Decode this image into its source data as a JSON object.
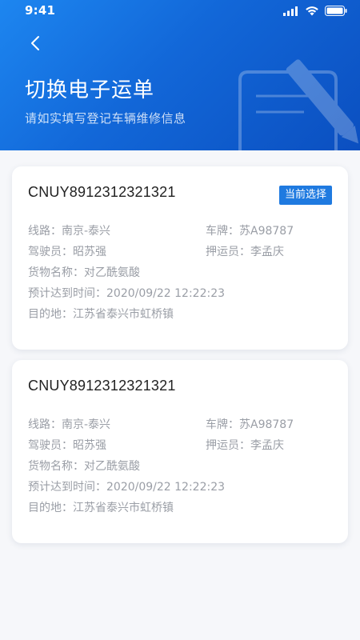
{
  "status_bar": {
    "time": "9:41"
  },
  "header": {
    "title": "切换电子运单",
    "subtitle": "请如实填写登记车辆维修信息"
  },
  "labels": {
    "route": "线路：",
    "plate": "车牌：",
    "driver": "驾驶员：",
    "escort": "押运员：",
    "cargo": "货物名称：",
    "eta": "预计达到时间：",
    "destination": "目的地："
  },
  "waybills": [
    {
      "number": "CNUY8912312321321",
      "badge": "当前选择",
      "route": "南京-泰兴",
      "plate": "苏A98787",
      "driver": "昭苏强",
      "escort": "李孟庆",
      "cargo": "对乙酰氨酸",
      "eta": "2020/09/22 12:22:23",
      "destination": "江苏省泰兴市虹桥镇"
    },
    {
      "number": "CNUY8912312321321",
      "route": "南京-泰兴",
      "plate": "苏A98787",
      "driver": "昭苏强",
      "escort": "李孟庆",
      "cargo": "对乙酰氨酸",
      "eta": "2020/09/22 12:22:23",
      "destination": "江苏省泰兴市虹桥镇"
    }
  ],
  "colors": {
    "header_blue": "#1267d8",
    "badge_blue": "#1f7ae0",
    "background": "#f6f7fa",
    "muted_text": "#9a9ea6"
  }
}
